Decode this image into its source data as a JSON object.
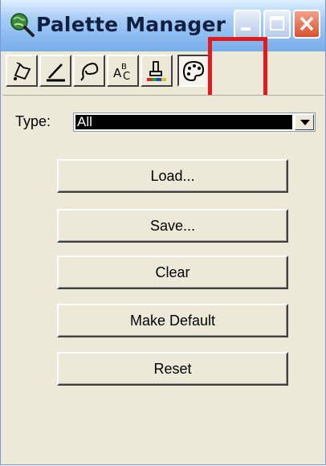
{
  "window": {
    "title": "Palette Manager",
    "title_buttons": [
      "minimize-icon",
      "maximize-icon",
      "close-icon"
    ]
  },
  "toolbar": {
    "tools": [
      {
        "name": "paint-bucket-icon",
        "pressed": false
      },
      {
        "name": "pencil-icon",
        "pressed": false
      },
      {
        "name": "lasso-icon",
        "pressed": false
      },
      {
        "name": "text-case-icon",
        "pressed": false,
        "glyph": "A B C"
      },
      {
        "name": "color-pen-icon",
        "pressed": false
      },
      {
        "name": "palette-icon",
        "pressed": true,
        "highlighted": true
      }
    ],
    "highlight_color": "#e01b1b"
  },
  "type_filter": {
    "label": "Type:",
    "selected": "All"
  },
  "buttons": {
    "load": "Load...",
    "save": "Save...",
    "clear": "Clear",
    "make_default": "Make Default",
    "reset": "Reset"
  },
  "colors": {
    "titlebar": "#8bbbf0",
    "face": "#ece9d8",
    "close": "#d9512f"
  }
}
